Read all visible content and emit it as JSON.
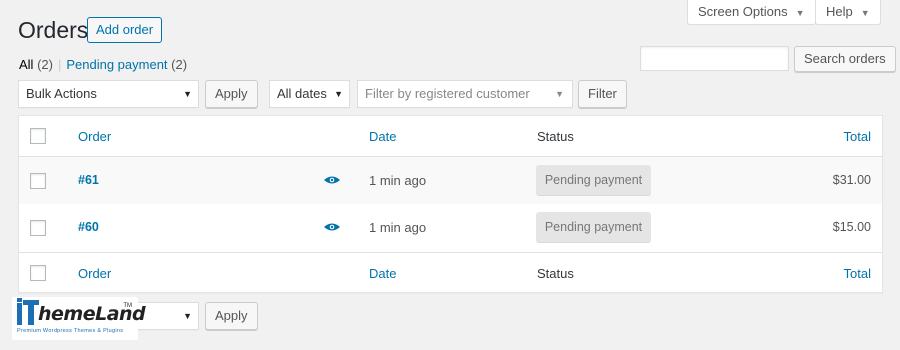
{
  "screen_meta": {
    "screen_options_label": "Screen Options",
    "help_label": "Help",
    "caret": "▼"
  },
  "header": {
    "title": "Orders",
    "add_button": "Add order"
  },
  "views": [
    {
      "label": "All",
      "count": "(2)"
    },
    {
      "label": "Pending payment",
      "count": "(2)"
    }
  ],
  "views_separator": "|",
  "search": {
    "value": "",
    "placeholder": "",
    "button": "Search orders"
  },
  "filters": {
    "bulk_actions": "Bulk Actions",
    "apply": "Apply",
    "dates": "All dates",
    "customer_placeholder": "Filter by registered customer",
    "filter_button": "Filter"
  },
  "table": {
    "columns": {
      "order": "Order",
      "date": "Date",
      "status": "Status",
      "total": "Total"
    },
    "rows": [
      {
        "order": "#61",
        "date": "1 min ago",
        "status": "Pending payment",
        "total": "$31.00"
      },
      {
        "order": "#60",
        "date": "1 min ago",
        "status": "Pending payment",
        "total": "$15.00"
      }
    ]
  },
  "bottom": {
    "apply": "Apply"
  },
  "watermark": {
    "brand": "iThemeLand",
    "tagline": "Premium Wordpress Themes & Plugins",
    "tm": "TM"
  },
  "icons": {
    "preview": "eye-icon",
    "caret": "caret-down-icon"
  },
  "colors": {
    "link": "#0073aa",
    "background": "#f1f1f1",
    "badge_bg": "#e5e5e5",
    "brand_blue": "#1b6fb5"
  }
}
